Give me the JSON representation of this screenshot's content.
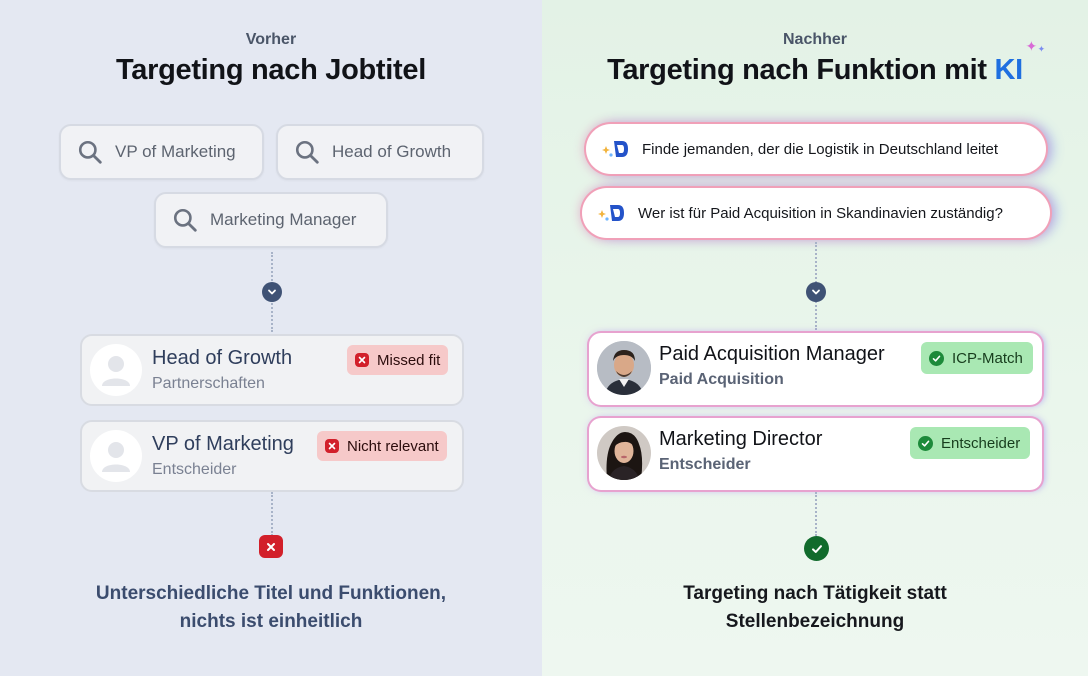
{
  "before": {
    "eyebrow": "Vorher",
    "title": "Targeting nach Jobtitel",
    "searches": [
      "VP of Marketing",
      "Head of Growth",
      "Marketing Manager"
    ],
    "results": [
      {
        "name": "Head of Growth",
        "sub": "Partnerschaften",
        "badge": "Missed fit"
      },
      {
        "name": "VP of Marketing",
        "sub": "Entscheider",
        "badge": "Nicht relevant"
      }
    ],
    "caption_line1": "Unterschiedliche Titel und Funktionen,",
    "caption_line2": "nichts ist einheitlich"
  },
  "after": {
    "eyebrow": "Nachher",
    "title_main": "Targeting nach Funktion mit",
    "title_accent": "KI",
    "prompts": [
      "Finde jemanden, der die Logistik in Deutschland leitet",
      "Wer ist für Paid Acquisition in Skandinavien zuständig?"
    ],
    "results": [
      {
        "name": "Paid Acquisition Manager",
        "sub": "Paid Acquisition",
        "badge": "ICP-Match"
      },
      {
        "name": "Marketing Director",
        "sub": "Entscheider",
        "badge": "Entscheider"
      }
    ],
    "caption_line1": "Targeting nach Tätigkeit statt",
    "caption_line2": "Stellenbezeichnung"
  },
  "colors": {
    "bad": "#d21f2a",
    "good": "#1d8a3a",
    "accent": "#1f6fe0",
    "node": "#3f5275"
  },
  "icons": [
    "search-icon",
    "chevron-down-icon",
    "avatar-placeholder-icon",
    "close-icon",
    "check-icon",
    "ai-sparkle-icon"
  ]
}
